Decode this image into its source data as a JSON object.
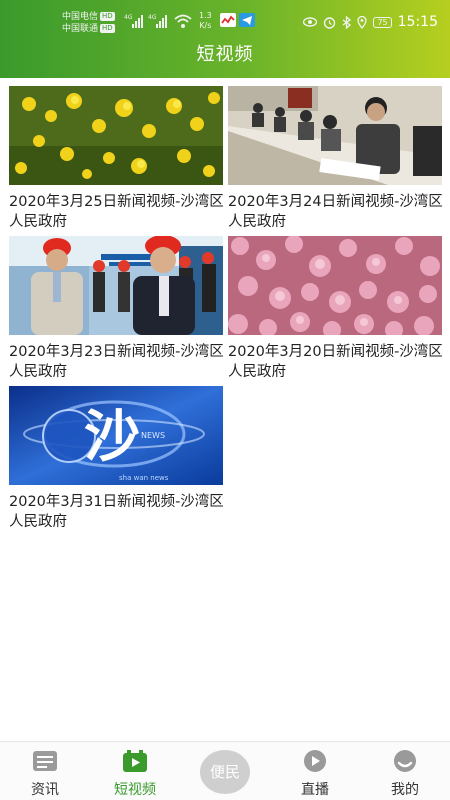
{
  "status_bar": {
    "carrier_1": "中国电信",
    "carrier_2": "中国联通",
    "hd": "HD",
    "net_1": "4G",
    "net_2": "4G",
    "speed_value": "1.3",
    "speed_unit": "K/s",
    "battery": "75",
    "time": "15:15"
  },
  "header": {
    "title": "短视频"
  },
  "videos": [
    {
      "title": "2020年3月25日新闻视频-沙湾区人民政府",
      "thumb": "yellow-flowers"
    },
    {
      "title": "2020年3月24日新闻视频-沙湾区人民政府",
      "thumb": "meeting-room"
    },
    {
      "title": "2020年3月23日新闻视频-沙湾区人民政府",
      "thumb": "hard-hat-officials"
    },
    {
      "title": "2020年3月20日新闻视频-沙湾区人民政府",
      "thumb": "pink-blossoms"
    },
    {
      "title": "2020年3月31日新闻视频-沙湾区人民政府",
      "thumb": "sha-news-logo"
    }
  ],
  "thumb_overlay": {
    "logo_char": "沙",
    "news_word": "NEWS",
    "watermark": "sha wan news"
  },
  "tabs": [
    {
      "label": "资讯",
      "icon": "news-icon"
    },
    {
      "label": "短视频",
      "icon": "video-icon"
    },
    {
      "label": "便民",
      "icon": "convenience-icon"
    },
    {
      "label": "直播",
      "icon": "live-play-icon"
    },
    {
      "label": "我的",
      "icon": "profile-icon"
    }
  ],
  "colors": {
    "header_start": "#3a9a2c",
    "header_end": "#b6cf1f",
    "active_tab": "#3a9a2c"
  }
}
